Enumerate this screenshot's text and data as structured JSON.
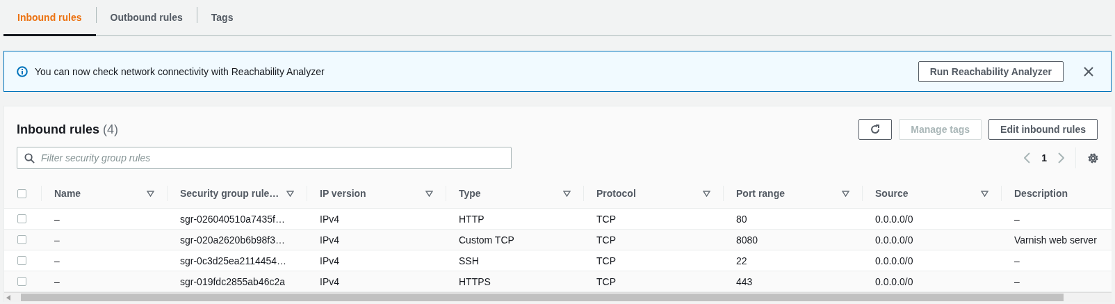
{
  "tabs": [
    {
      "label": "Inbound rules",
      "selected": true
    },
    {
      "label": "Outbound rules",
      "selected": false
    },
    {
      "label": "Tags",
      "selected": false
    }
  ],
  "alert": {
    "message": "You can now check network connectivity with Reachability Analyzer",
    "action": "Run Reachability Analyzer"
  },
  "panel": {
    "title": "Inbound rules",
    "count": "(4)",
    "buttons": [
      {
        "kind": "refresh",
        "disabled": false
      },
      {
        "kind": "text",
        "label": "Manage tags",
        "disabled": true
      },
      {
        "kind": "text",
        "label": "Edit inbound rules",
        "disabled": false
      }
    ],
    "search": {
      "placeholder": "Filter security group rules"
    },
    "pagination": {
      "page": "1"
    }
  },
  "table": {
    "select_all_checked": false,
    "columns": [
      "Name",
      "Security group rule…",
      "IP version",
      "Type",
      "Protocol",
      "Port range",
      "Source",
      "Description"
    ],
    "rows": [
      {
        "checked": false,
        "cells": [
          "–",
          "sgr-026040510a7435f…",
          "IPv4",
          "HTTP",
          "TCP",
          "80",
          "0.0.0.0/0",
          "–"
        ]
      },
      {
        "checked": false,
        "cells": [
          "–",
          "sgr-020a2620b6b98f3…",
          "IPv4",
          "Custom TCP",
          "TCP",
          "8080",
          "0.0.0.0/0",
          "Varnish web server"
        ]
      },
      {
        "checked": false,
        "cells": [
          "–",
          "sgr-0c3d25ea2114454…",
          "IPv4",
          "SSH",
          "TCP",
          "22",
          "0.0.0.0/0",
          "–"
        ]
      },
      {
        "checked": false,
        "cells": [
          "–",
          "sgr-019fdc2855ab46c2a",
          "IPv4",
          "HTTPS",
          "TCP",
          "443",
          "0.0.0.0/0",
          "–"
        ]
      }
    ]
  }
}
